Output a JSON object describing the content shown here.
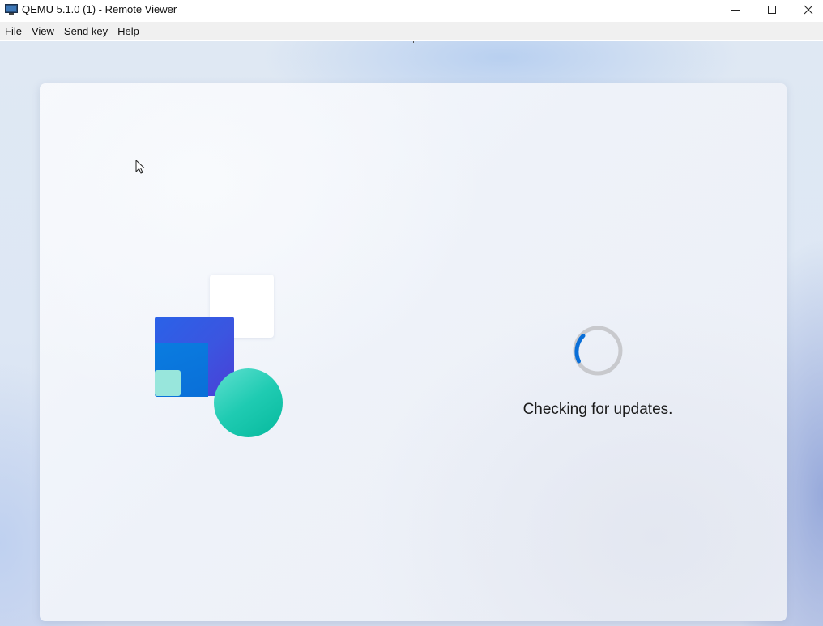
{
  "window": {
    "title": "QEMU 5.1.0 (1) - Remote Viewer",
    "app_icon": "monitor-icon",
    "controls": [
      "minimize-icon",
      "maximize-icon",
      "close-icon"
    ]
  },
  "menubar": {
    "items": [
      {
        "label": "File"
      },
      {
        "label": "View"
      },
      {
        "label": "Send key"
      },
      {
        "label": "Help"
      }
    ]
  },
  "vm": {
    "status": "Checking for updates.",
    "spinner_icon": "loading-spinner-icon",
    "accent_color": "#0a6fd8"
  }
}
